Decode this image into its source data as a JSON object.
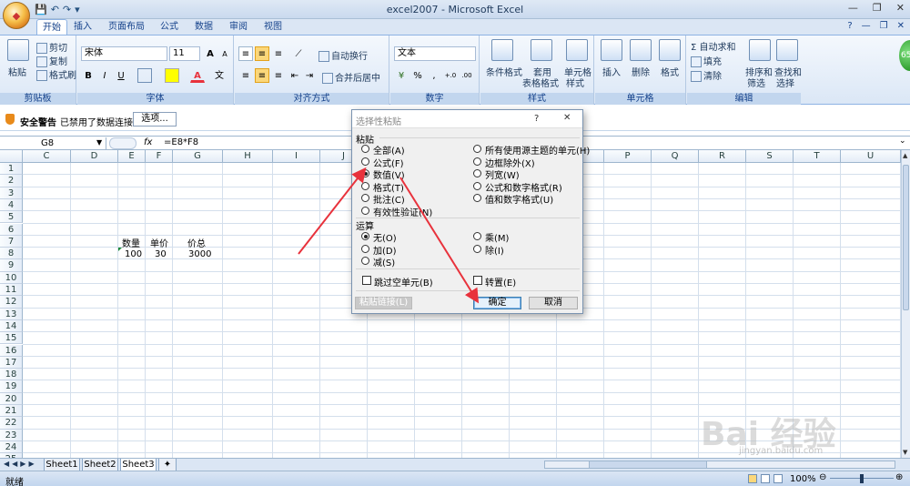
{
  "window": {
    "title": "excel2007 - Microsoft Excel",
    "controls": [
      "—",
      "❐",
      "✕"
    ]
  },
  "qat": {
    "save": "💾",
    "undo": "↶",
    "redo": "↷",
    "more": "▾"
  },
  "tabs": [
    "开始",
    "插入",
    "页面布局",
    "公式",
    "数据",
    "审阅",
    "视图"
  ],
  "help_icons": [
    "?",
    "—",
    "❐",
    "✕"
  ],
  "ribbon": {
    "clipboard": {
      "paste": "粘贴",
      "cut": "剪切",
      "copy": "复制",
      "painter": "格式刷",
      "label": "剪贴板"
    },
    "font": {
      "name": "宋体",
      "size": "11",
      "grow": "A",
      "shrink": "A",
      "bold": "B",
      "italic": "I",
      "underline": "U",
      "label": "字体"
    },
    "align": {
      "wrap": "自动换行",
      "merge": "合并后居中",
      "label": "对齐方式"
    },
    "number": {
      "format": "文本",
      "currency": "%",
      "comma": ",",
      "inc": "+.0",
      "dec": ".00",
      "label": "数字"
    },
    "styles": {
      "cond": "条件格式",
      "table1": "套用",
      "table2": "表格格式",
      "cell1": "单元格",
      "cell2": "样式",
      "label": "样式"
    },
    "cells": {
      "insert": "插入",
      "delete": "删除",
      "format": "格式",
      "label": "单元格"
    },
    "editing": {
      "autosum": "自动求和",
      "fill": "填充",
      "clear": "清除",
      "sort1": "排序和",
      "sort2": "筛选",
      "find1": "查找和",
      "find2": "选择",
      "label": "编辑"
    }
  },
  "security": {
    "title": "安全警告",
    "message": "已禁用了数据连接",
    "options": "选项..."
  },
  "formula_bar": {
    "namebox": "G8",
    "fx": "fx",
    "formula": "=E8*F8"
  },
  "grid": {
    "columns": [
      "C",
      "D",
      "E",
      "F",
      "G",
      "H",
      "I",
      "J",
      "K",
      "L",
      "M",
      "N",
      "O",
      "P",
      "Q",
      "R",
      "S",
      "T",
      "U"
    ],
    "rows": [
      "1",
      "2",
      "3",
      "4",
      "5",
      "6",
      "7",
      "8",
      "9",
      "10",
      "11",
      "12",
      "13",
      "14",
      "15",
      "16",
      "17",
      "18",
      "19",
      "20",
      "21",
      "22",
      "23",
      "24",
      "25"
    ],
    "cells": {
      "e7": "数量",
      "f7": "单价",
      "g7": "价总",
      "e8": "100",
      "f8": "30",
      "g8": "3000"
    }
  },
  "sheets": [
    "Sheet1",
    "Sheet2",
    "Sheet3"
  ],
  "status": {
    "ready": "就绪",
    "zoom": "100%"
  },
  "dialog": {
    "title": "选择性粘贴",
    "help": "?",
    "close": "✕",
    "paste_label": "粘贴",
    "paste_options_left": [
      "全部(A)",
      "公式(F)",
      "数值(V)",
      "格式(T)",
      "批注(C)",
      "有效性验证(N)"
    ],
    "paste_options_right": [
      "所有使用源主题的单元(H)",
      "边框除外(X)",
      "列宽(W)",
      "公式和数字格式(R)",
      "值和数字格式(U)"
    ],
    "operation_label": "运算",
    "ops_left": [
      "无(O)",
      "加(D)",
      "减(S)"
    ],
    "ops_right": [
      "乘(M)",
      "除(I)"
    ],
    "skip_blanks": "跳过空单元(B)",
    "transpose": "转置(E)",
    "paste_link": "粘贴链接(L)",
    "ok": "确定",
    "cancel": "取消"
  },
  "watermark": {
    "main": "Bai 经验",
    "sub": "jingyan.baidu.com"
  },
  "avatar_badge": "65",
  "accent": "#e8323c"
}
